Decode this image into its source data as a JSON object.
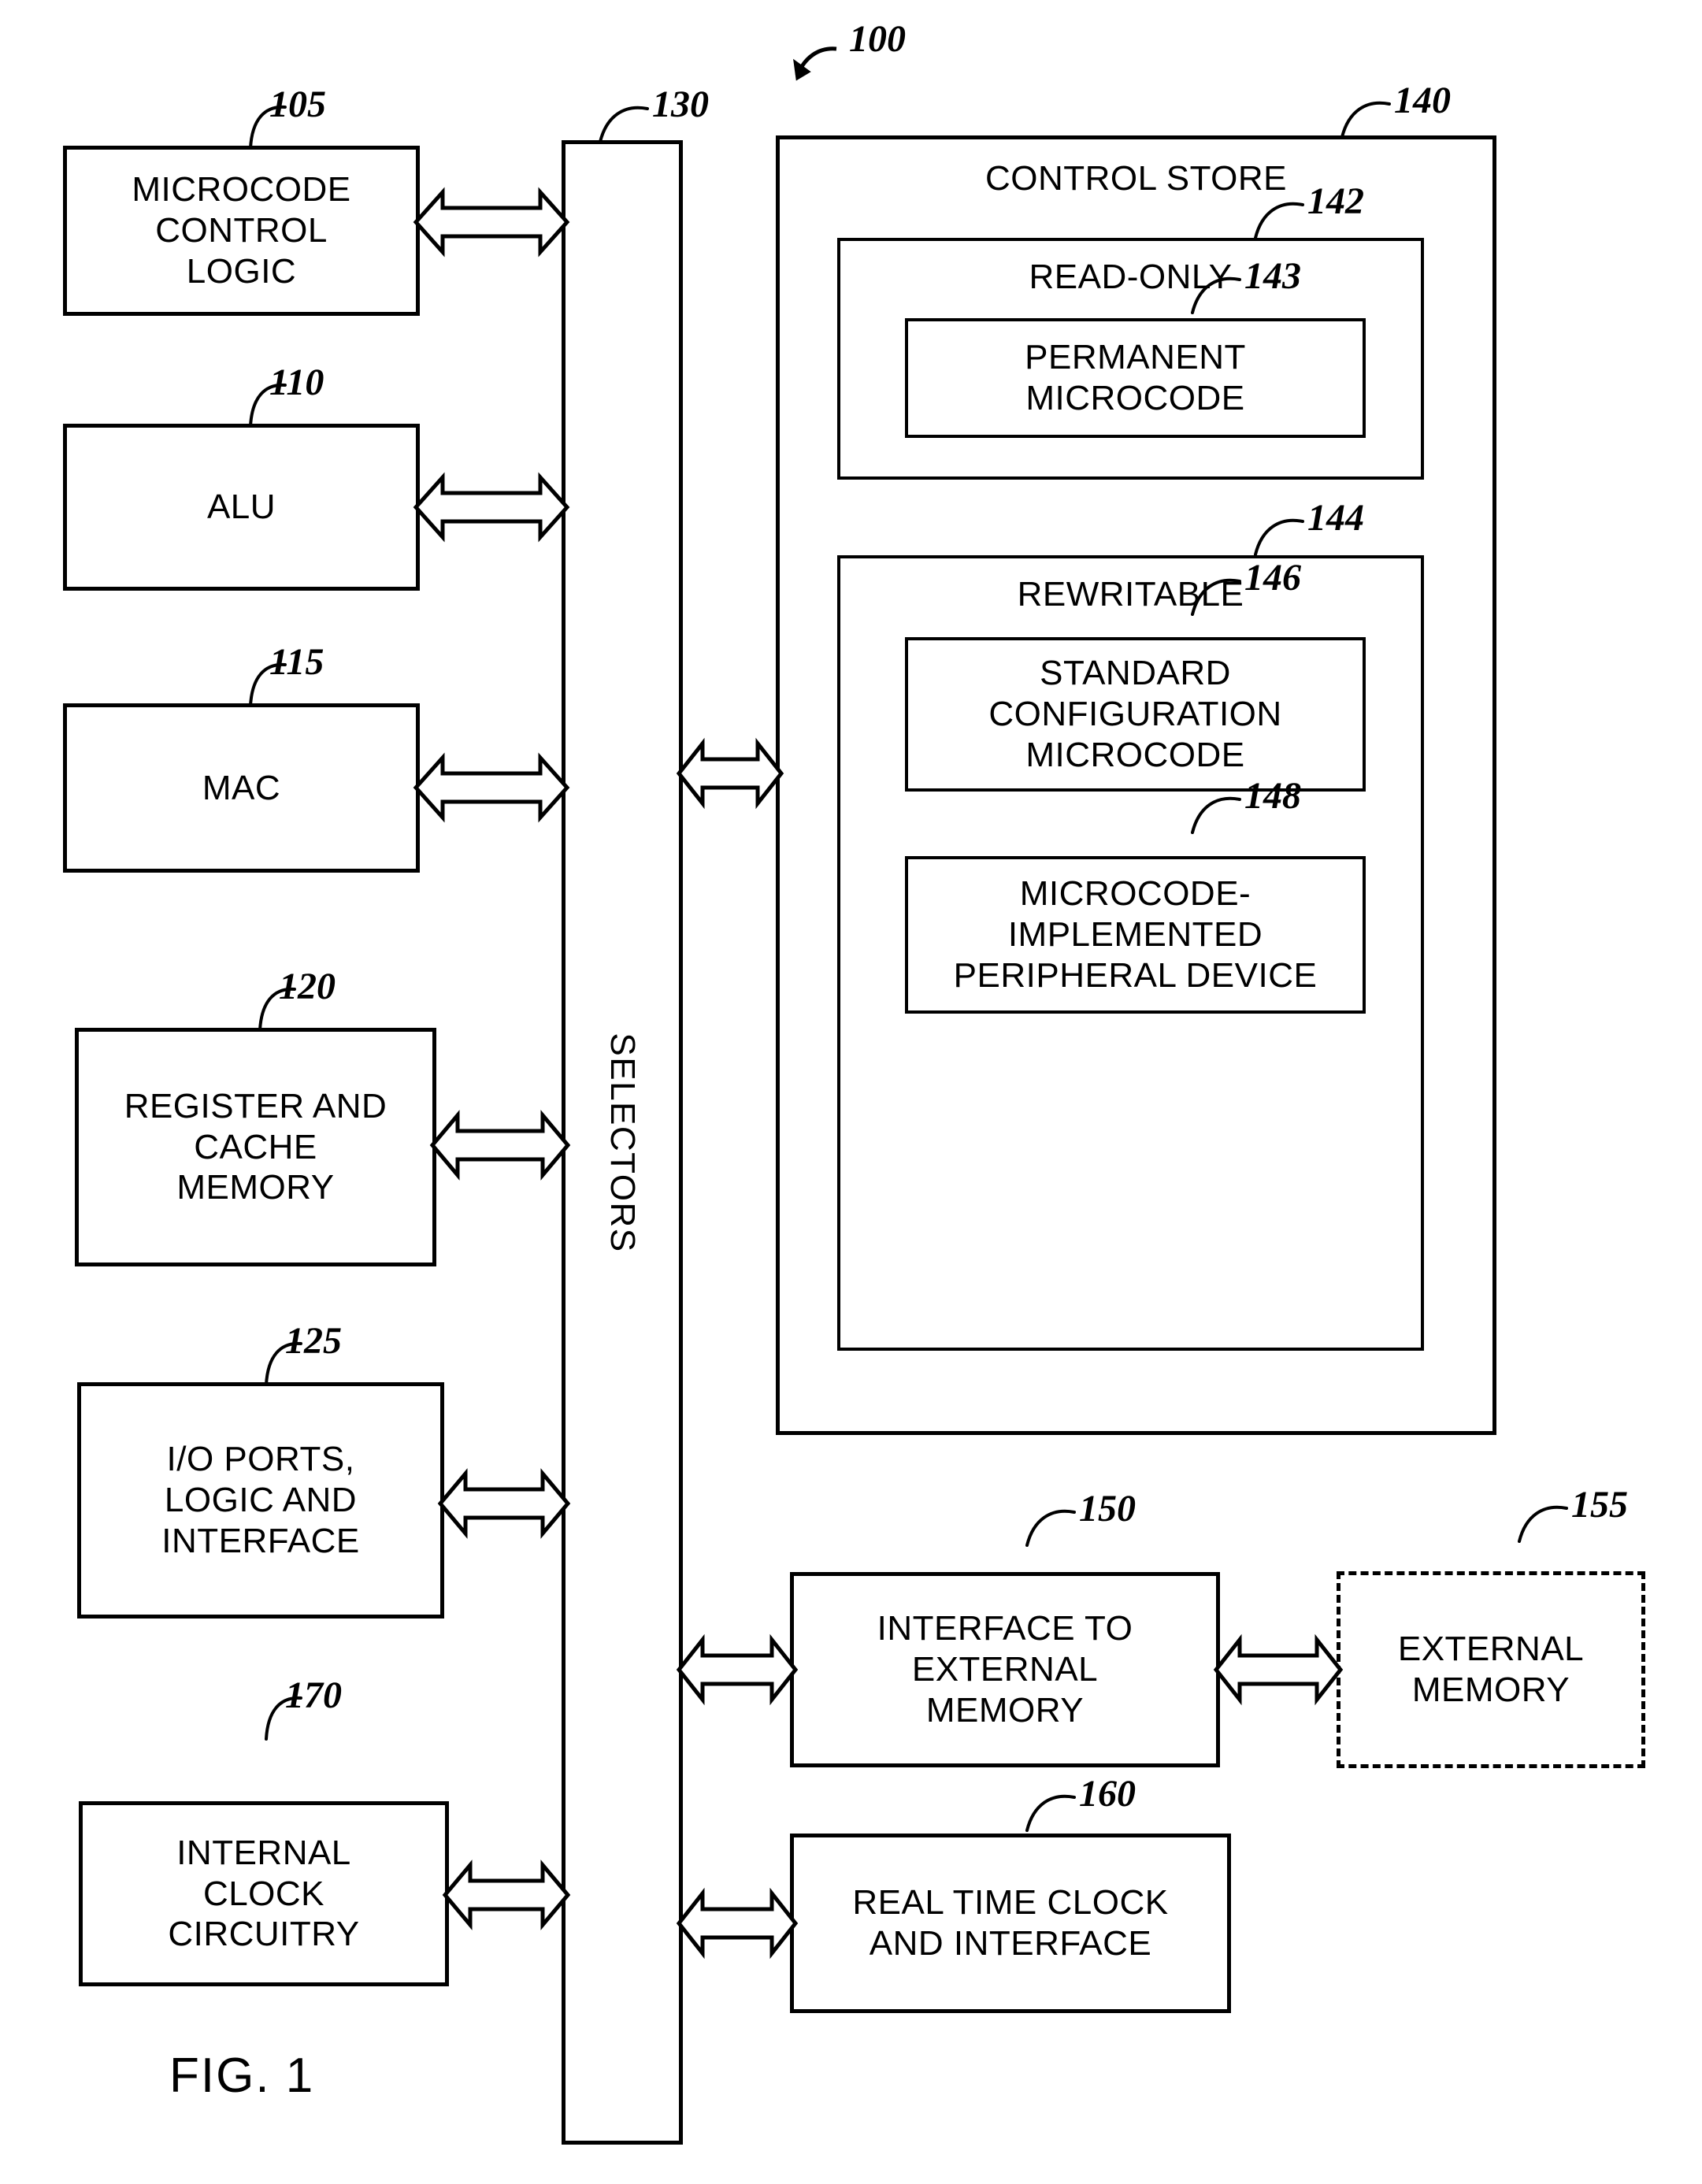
{
  "figure": {
    "caption": "FIG. 1",
    "system_ref": "100"
  },
  "blocks": {
    "microcode_control_logic": {
      "ref": "105",
      "label": "MICROCODE\nCONTROL\nLOGIC"
    },
    "alu": {
      "ref": "110",
      "label": "ALU"
    },
    "mac": {
      "ref": "115",
      "label": "MAC"
    },
    "register_cache_memory": {
      "ref": "120",
      "label": "REGISTER AND\nCACHE\nMEMORY"
    },
    "io_ports": {
      "ref": "125",
      "label": "I/O PORTS,\nLOGIC AND\nINTERFACE"
    },
    "selectors": {
      "ref": "130",
      "label": "SELECTORS"
    },
    "control_store": {
      "ref": "140",
      "label": "CONTROL STORE"
    },
    "read_only": {
      "ref": "142",
      "label": "READ-ONLY"
    },
    "permanent_microcode": {
      "ref": "143",
      "label": "PERMANENT\nMICROCODE"
    },
    "rewritable": {
      "ref": "144",
      "label": "REWRITABLE"
    },
    "standard_config_microcode": {
      "ref": "146",
      "label": "STANDARD\nCONFIGURATION\nMICROCODE"
    },
    "microcode_peripheral": {
      "ref": "148",
      "label": "MICROCODE-\nIMPLEMENTED\nPERIPHERAL DEVICE"
    },
    "interface_external_memory": {
      "ref": "150",
      "label": "INTERFACE TO\nEXTERNAL\nMEMORY"
    },
    "external_memory": {
      "ref": "155",
      "label": "EXTERNAL\nMEMORY"
    },
    "real_time_clock": {
      "ref": "160",
      "label": "REAL TIME CLOCK\nAND INTERFACE"
    },
    "internal_clock": {
      "ref": "170",
      "label": "INTERNAL\nCLOCK\nCIRCUITRY"
    }
  },
  "colors": {
    "line": "#000000",
    "background": "#ffffff"
  }
}
